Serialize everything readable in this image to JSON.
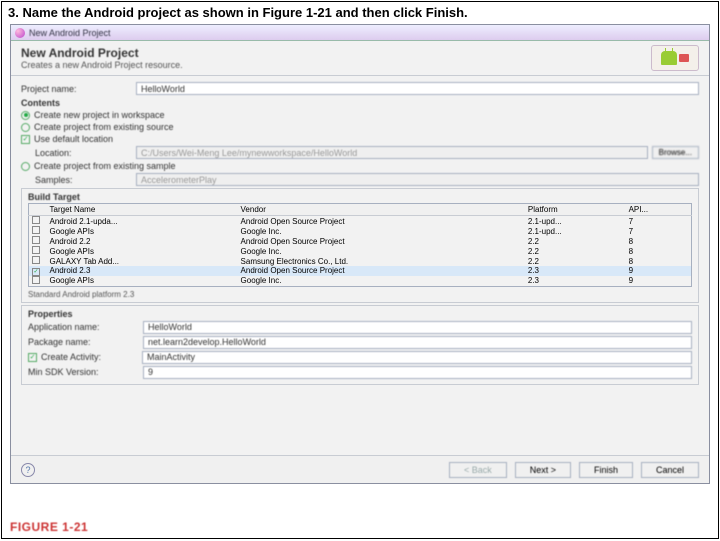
{
  "instruction": "3. Name the Android project as shown in Figure 1-21 and then click Finish.",
  "window_title": "New Android Project",
  "header": {
    "title": "New Android Project",
    "subtitle": "Creates a new Android Project resource."
  },
  "project_name": {
    "label": "Project name:",
    "value": "HelloWorld"
  },
  "contents": {
    "title": "Contents",
    "create_new": "Create new project in workspace",
    "from_existing": "Create project from existing source",
    "use_default": "Use default location",
    "location_label": "Location:",
    "location_value": "C:/Users/Wei-Meng Lee/mynewworkspace/HelloWorld",
    "browse": "Browse...",
    "from_sample": "Create project from existing sample",
    "samples_label": "Samples:",
    "samples_value": "AccelerometerPlay"
  },
  "build": {
    "title": "Build Target",
    "cols": {
      "name": "Target Name",
      "vendor": "Vendor",
      "platform": "Platform",
      "api": "API..."
    },
    "rows": [
      {
        "chk": "",
        "name": "Android 2.1-upda...",
        "vendor": "Android Open Source Project",
        "platform": "2.1-upd...",
        "api": "7"
      },
      {
        "chk": "",
        "name": "Google APIs",
        "vendor": "Google Inc.",
        "platform": "2.1-upd...",
        "api": "7"
      },
      {
        "chk": "",
        "name": "Android 2.2",
        "vendor": "Android Open Source Project",
        "platform": "2.2",
        "api": "8"
      },
      {
        "chk": "",
        "name": "Google APIs",
        "vendor": "Google Inc.",
        "platform": "2.2",
        "api": "8"
      },
      {
        "chk": "",
        "name": "GALAXY Tab Add...",
        "vendor": "Samsung Electronics Co., Ltd.",
        "platform": "2.2",
        "api": "8"
      },
      {
        "chk": "✓",
        "name": "Android 2.3",
        "vendor": "Android Open Source Project",
        "platform": "2.3",
        "api": "9"
      },
      {
        "chk": "",
        "name": "Google APIs",
        "vendor": "Google Inc.",
        "platform": "2.3",
        "api": "9"
      }
    ],
    "note": "Standard Android platform 2.3"
  },
  "props": {
    "title": "Properties",
    "app_label": "Application name:",
    "app_value": "HelloWorld",
    "pkg_label": "Package name:",
    "pkg_value": "net.learn2develop.HelloWorld",
    "act_label": "Create Activity:",
    "act_value": "MainActivity",
    "sdk_label": "Min SDK Version:",
    "sdk_value": "9"
  },
  "buttons": {
    "back": "< Back",
    "next": "Next >",
    "finish": "Finish",
    "cancel": "Cancel"
  },
  "figure": "FIGURE 1-21"
}
